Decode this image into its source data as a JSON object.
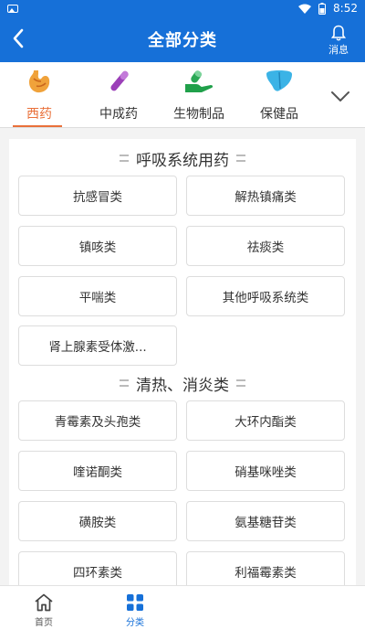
{
  "status_bar": {
    "time": "8:52"
  },
  "header": {
    "title": "全部分类",
    "message_label": "消息"
  },
  "tabs": [
    {
      "label": "西药",
      "icon": "stomach-icon",
      "active": true
    },
    {
      "label": "中成药",
      "icon": "capsule-pen-icon",
      "active": false
    },
    {
      "label": "生物制品",
      "icon": "pill-hand-icon",
      "active": false
    },
    {
      "label": "保健品",
      "icon": "liver-icon",
      "active": false
    }
  ],
  "sections": [
    {
      "title": "呼吸系统用药",
      "items": [
        "抗感冒类",
        "解热镇痛类",
        "镇咳类",
        "祛痰类",
        "平喘类",
        "其他呼吸系统类",
        "肾上腺素受体激..."
      ]
    },
    {
      "title": "清热、消炎类",
      "items": [
        "青霉素及头孢类",
        "大环内酯类",
        "喹诺酮类",
        "硝基咪唑类",
        "磺胺类",
        "氨基糖苷类",
        "四环素类",
        "利福霉素类"
      ]
    }
  ],
  "bottom_nav": [
    {
      "label": "首页",
      "icon": "home-icon",
      "active": false
    },
    {
      "label": "分类",
      "icon": "grid-icon",
      "active": true
    }
  ],
  "colors": {
    "primary": "#1670d8",
    "accent": "#e9703a"
  }
}
